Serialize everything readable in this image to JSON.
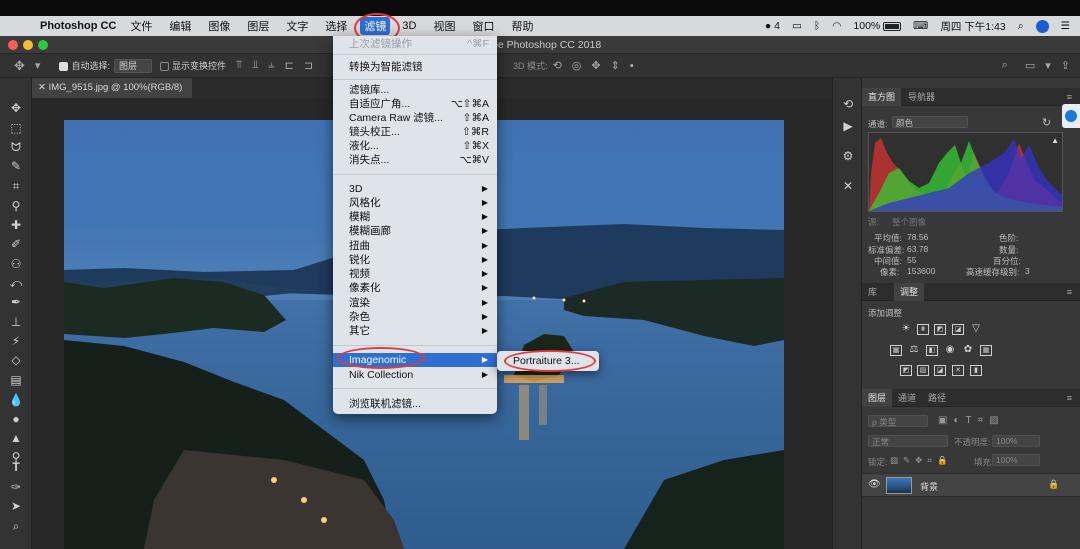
{
  "menubar": {
    "app_name": "Photoshop CC",
    "items": [
      "文件",
      "编辑",
      "图像",
      "图层",
      "文字",
      "选择",
      "滤镜",
      "3D",
      "视图",
      "窗口",
      "帮助"
    ],
    "active_index": 6,
    "status": {
      "notifications": "4",
      "battery": "100%",
      "clock": "周四 下午1:43"
    }
  },
  "window": {
    "title": "Adobe Photoshop CC 2018",
    "title_visible": "pe Photoshop CC 2018"
  },
  "options_bar": {
    "auto_select_label": "自动选择:",
    "auto_select_value": "图层",
    "show_transform_label": "显示变换控件",
    "mode_3d_label": "3D 模式:"
  },
  "document": {
    "tab_label": "IMG_9515.jpg @ 100%(RGB/8)"
  },
  "filter_menu": {
    "items": [
      {
        "label": "上次滤镜操作",
        "shortcut": "^⌘F",
        "disabled": true
      },
      {
        "label": "转换为智能滤镜"
      },
      {
        "label": "滤镜库..."
      },
      {
        "label": "自适应广角...",
        "shortcut": "⌥⇧⌘A"
      },
      {
        "label": "Camera Raw 滤镜...",
        "shortcut": "⇧⌘A"
      },
      {
        "label": "镜头校正...",
        "shortcut": "⇧⌘R"
      },
      {
        "label": "液化...",
        "shortcut": "⇧⌘X"
      },
      {
        "label": "消失点...",
        "shortcut": "⌥⌘V"
      },
      {
        "label": "3D"
      },
      {
        "label": "风格化"
      },
      {
        "label": "模糊"
      },
      {
        "label": "模糊画廊"
      },
      {
        "label": "扭曲"
      },
      {
        "label": "锐化"
      },
      {
        "label": "视频"
      },
      {
        "label": "像素化"
      },
      {
        "label": "渲染"
      },
      {
        "label": "杂色"
      },
      {
        "label": "其它"
      },
      {
        "label": "Imagenomic"
      },
      {
        "label": "Nik Collection"
      },
      {
        "label": "浏览联机滤镜..."
      }
    ],
    "submenu_item": "Portraiture 3..."
  },
  "histogram_panel": {
    "tabs": [
      "直方图",
      "导航器"
    ],
    "channel_label": "通道:",
    "channel_value": "颜色",
    "source_label": "源:",
    "source_value": "整个图像",
    "stats": {
      "mean_label": "平均值:",
      "mean": "78.56",
      "std_label": "标准偏差:",
      "std": "63.78",
      "median_label": "中间值:",
      "median": "55",
      "pixels_label": "像素:",
      "pixels": "153600",
      "level_label": "色阶:",
      "count_label": "数量:",
      "percentile_label": "百分位:",
      "cache_label": "高速缓存级别:",
      "cache": "3"
    }
  },
  "adjust_panel": {
    "tabs": [
      "库",
      "调整"
    ],
    "add_label": "添加调整"
  },
  "layers_panel": {
    "tabs": [
      "图层",
      "通道",
      "路径"
    ],
    "kind_label": "ρ 类型",
    "blend_mode": "正常",
    "opacity_label": "不透明度:",
    "opacity": "100%",
    "lock_label": "锁定:",
    "fill_label": "填充:",
    "fill": "100%",
    "layer_name": "背景"
  },
  "colors": {
    "menu_highlight": "#2f6fd1",
    "annotation_ring": "#e23b3b",
    "menu_bg": "#dfe3ea"
  }
}
